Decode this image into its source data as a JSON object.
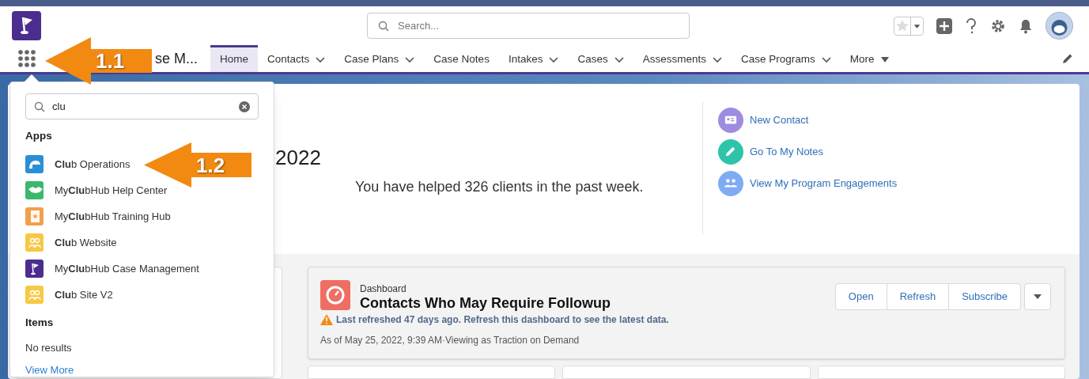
{
  "header": {
    "search": {
      "placeholder": "Search..."
    }
  },
  "nav": {
    "app_name": "se M...",
    "tabs": [
      {
        "label": "Home",
        "selected": true,
        "kind": "plain"
      },
      {
        "label": "Contacts",
        "selected": false,
        "kind": "dropdown"
      },
      {
        "label": "Case Plans",
        "selected": false,
        "kind": "dropdown"
      },
      {
        "label": "Case Notes",
        "selected": false,
        "kind": "plain"
      },
      {
        "label": "Intakes",
        "selected": false,
        "kind": "dropdown"
      },
      {
        "label": "Cases",
        "selected": false,
        "kind": "dropdown"
      },
      {
        "label": "Assessments",
        "selected": false,
        "kind": "dropdown"
      },
      {
        "label": "Case Programs",
        "selected": false,
        "kind": "dropdown"
      },
      {
        "label": "More",
        "selected": false,
        "kind": "overflow"
      }
    ]
  },
  "welcome": {
    "year": "2022",
    "summary": "You have helped 326 clients in the past week."
  },
  "quick_links": [
    {
      "label": "New Contact",
      "kind": "contact",
      "color": "#9e8ce0"
    },
    {
      "label": "Go To My Notes",
      "kind": "note",
      "color": "#2ec4a9"
    },
    {
      "label": "View My Program Engagements",
      "kind": "group",
      "color": "#7fabf5"
    }
  ],
  "dashboard": {
    "caption": "Dashboard",
    "title": "Contacts Who May Require Followup",
    "warning": "Last refreshed 47 days ago. Refresh this dashboard to see the latest data.",
    "as_of": "As of May 25, 2022, 9:39 AM·Viewing as Traction on Demand",
    "buttons": [
      "Open",
      "Refresh",
      "Subscribe"
    ]
  },
  "app_launcher": {
    "search": {
      "value": "clu"
    },
    "apps_heading": "Apps",
    "apps": [
      {
        "label": "**Clu**b Operations",
        "kind": "building",
        "color": "#2a8fd6"
      },
      {
        "label": "My**Clu**bHub Help Center",
        "kind": "handshake",
        "color": "#3cb86a"
      },
      {
        "label": "My**Clu**bHub Training Hub",
        "kind": "book",
        "color": "#f0a04b"
      },
      {
        "label": "**Clu**b Website",
        "kind": "group",
        "color": "#f7c844"
      },
      {
        "label": "My**Clu**bHub Case Management",
        "kind": "flag",
        "color": "#4b2d8f"
      },
      {
        "label": "**Clu**b Site V2",
        "kind": "group",
        "color": "#f7c844"
      }
    ],
    "items_heading": "Items",
    "no_results": "No results",
    "view_more": "View More"
  },
  "callouts": [
    "1.1",
    "1.2"
  ]
}
